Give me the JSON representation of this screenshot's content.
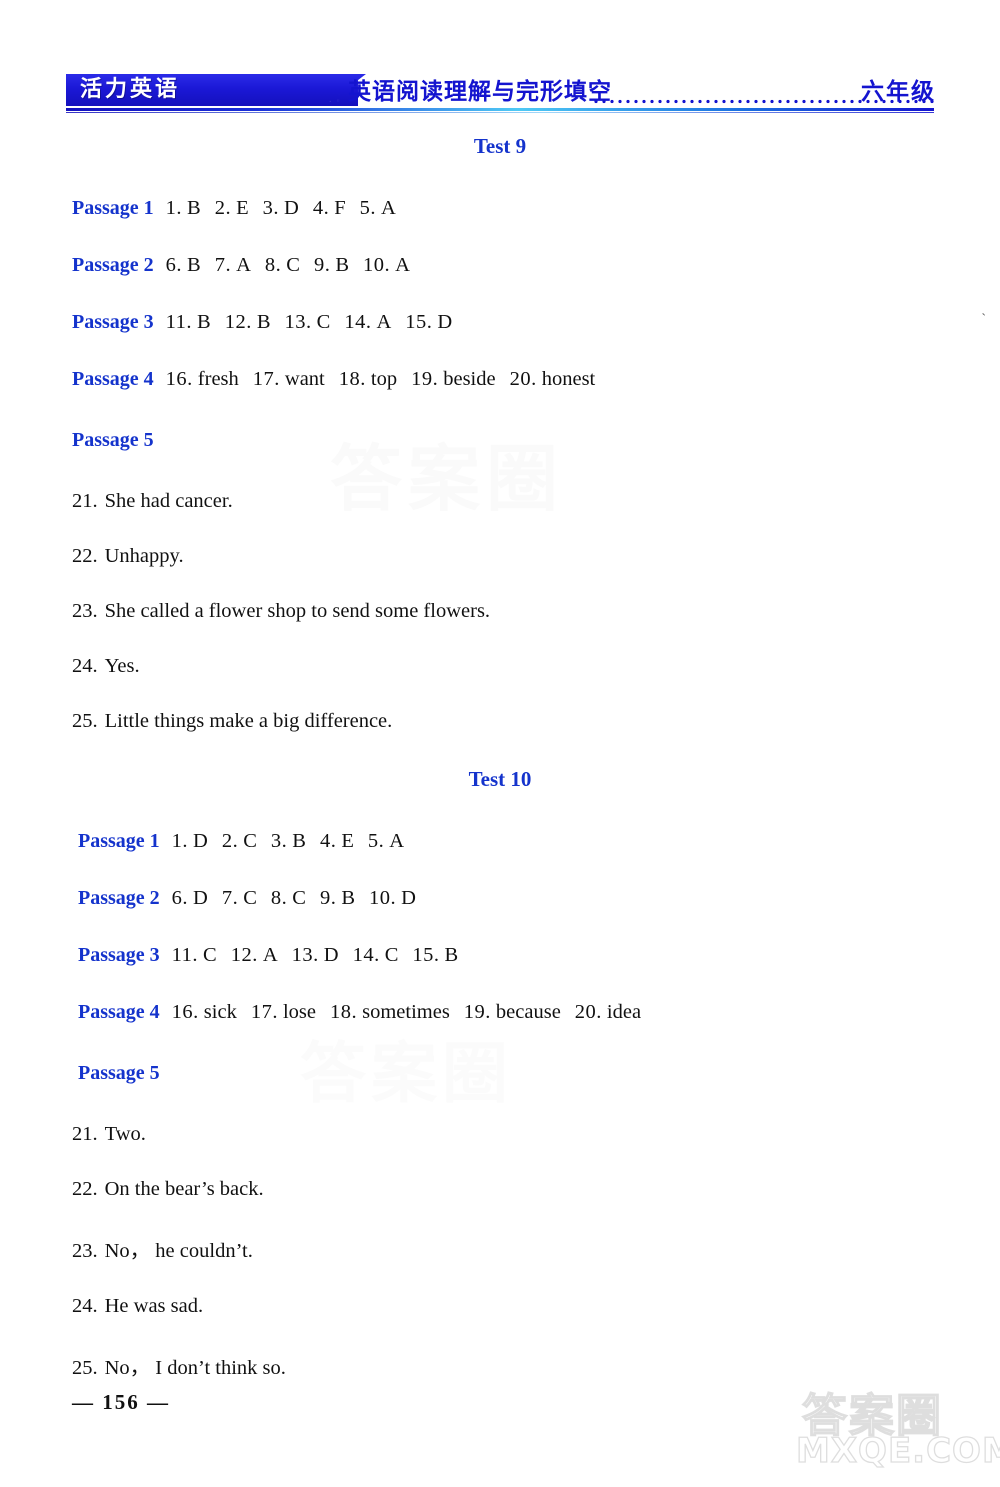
{
  "header": {
    "brand": "活力英语",
    "title": "英语阅读理解与完形填空",
    "grade": "六年级"
  },
  "tests": [
    {
      "heading": "Test 9",
      "passages": [
        {
          "label": "Passage 1",
          "answers": [
            {
              "num": "1.",
              "val": "B"
            },
            {
              "num": "2.",
              "val": "E"
            },
            {
              "num": "3.",
              "val": "D"
            },
            {
              "num": "4.",
              "val": "F"
            },
            {
              "num": "5.",
              "val": "A"
            }
          ]
        },
        {
          "label": "Passage 2",
          "answers": [
            {
              "num": "6.",
              "val": "B"
            },
            {
              "num": "7.",
              "val": "A"
            },
            {
              "num": "8.",
              "val": "C"
            },
            {
              "num": "9.",
              "val": "B"
            },
            {
              "num": "10.",
              "val": "A"
            }
          ]
        },
        {
          "label": "Passage 3",
          "answers": [
            {
              "num": "11.",
              "val": "B"
            },
            {
              "num": "12.",
              "val": "B"
            },
            {
              "num": "13.",
              "val": "C"
            },
            {
              "num": "14.",
              "val": "A"
            },
            {
              "num": "15.",
              "val": "D"
            }
          ]
        },
        {
          "label": "Passage 4",
          "answers": [
            {
              "num": "16.",
              "val": "fresh"
            },
            {
              "num": "17.",
              "val": "want"
            },
            {
              "num": "18.",
              "val": "top"
            },
            {
              "num": "19.",
              "val": "beside"
            },
            {
              "num": "20.",
              "val": "honest"
            }
          ]
        },
        {
          "label": "Passage 5",
          "answers": []
        }
      ],
      "long_answers": [
        {
          "num": "21.",
          "text": "She had cancer."
        },
        {
          "num": "22.",
          "text": "Unhappy."
        },
        {
          "num": "23.",
          "text": "She called a flower shop to send some flowers."
        },
        {
          "num": "24.",
          "text": "Yes."
        },
        {
          "num": "25.",
          "text": "Little things make a big difference."
        }
      ]
    },
    {
      "heading": "Test 10",
      "passages": [
        {
          "label": "Passage 1",
          "answers": [
            {
              "num": "1.",
              "val": "D"
            },
            {
              "num": "2.",
              "val": "C"
            },
            {
              "num": "3.",
              "val": "B"
            },
            {
              "num": "4.",
              "val": "E"
            },
            {
              "num": "5.",
              "val": "A"
            }
          ]
        },
        {
          "label": "Passage 2",
          "answers": [
            {
              "num": "6.",
              "val": "D"
            },
            {
              "num": "7.",
              "val": "C"
            },
            {
              "num": "8.",
              "val": "C"
            },
            {
              "num": "9.",
              "val": "B"
            },
            {
              "num": "10.",
              "val": "D"
            }
          ]
        },
        {
          "label": "Passage 3",
          "answers": [
            {
              "num": "11.",
              "val": "C"
            },
            {
              "num": "12.",
              "val": "A"
            },
            {
              "num": "13.",
              "val": "D"
            },
            {
              "num": "14.",
              "val": "C"
            },
            {
              "num": "15.",
              "val": "B"
            }
          ]
        },
        {
          "label": "Passage 4",
          "answers": [
            {
              "num": "16.",
              "val": "sick"
            },
            {
              "num": "17.",
              "val": "lose"
            },
            {
              "num": "18.",
              "val": "sometimes"
            },
            {
              "num": "19.",
              "val": "because"
            },
            {
              "num": "20.",
              "val": "idea"
            }
          ]
        },
        {
          "label": "Passage 5",
          "answers": []
        }
      ],
      "long_answers": [
        {
          "num": "21.",
          "text": "Two."
        },
        {
          "num": "22.",
          "text": "On the bear’s back."
        },
        {
          "num": "23.",
          "text": "No， he couldn’t."
        },
        {
          "num": "24.",
          "text": "He was sad."
        },
        {
          "num": "25.",
          "text": "No， I don’t think so."
        }
      ]
    }
  ],
  "footer": {
    "page_number": "— 156 —"
  },
  "watermark": {
    "chinese": "答案圈",
    "domain": "MXQE.COM"
  },
  "colors": {
    "brand_blue": "#1410bd",
    "heading_blue": "#1433cc",
    "text_black": "#111111"
  }
}
